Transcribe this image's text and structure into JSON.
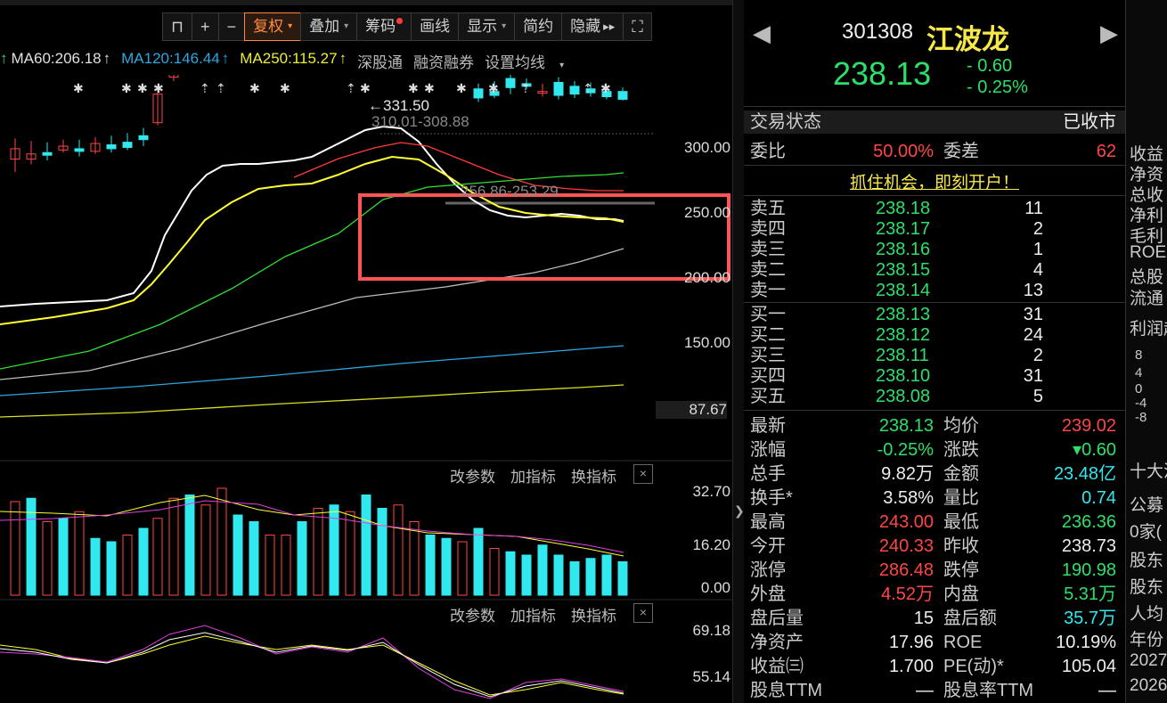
{
  "toolbar": {
    "items": [
      {
        "label": "",
        "icon": "lock-icon"
      },
      {
        "label": "+",
        "icon": "zoom-in-icon"
      },
      {
        "label": "−",
        "icon": "zoom-out-icon"
      },
      {
        "label": "复权",
        "dropdown": true,
        "selected": true
      },
      {
        "label": "叠加",
        "dropdown": true
      },
      {
        "label": "筹码",
        "badge": true
      },
      {
        "label": "画线"
      },
      {
        "label": "显示",
        "dropdown": true
      },
      {
        "label": "简约"
      },
      {
        "label": "隐藏",
        "arrow": "▸▸"
      },
      {
        "label": "",
        "icon": "fullscreen-icon"
      }
    ]
  },
  "ma_legend": {
    "ma60": "MA60:206.18",
    "ma120": "MA120:146.44",
    "ma250": "MA250:115.27",
    "arrow": "↑",
    "links": [
      "深股通",
      "融资融券"
    ],
    "setting": "设置均线"
  },
  "chart": {
    "annotations": {
      "high_label": "←331.50",
      "high_range": "310.01-308.88",
      "mid_range": "256.86-253.29"
    },
    "price_axis": [
      "300.00",
      "250.00",
      "200.00",
      "150.00"
    ],
    "min_label": "87.67",
    "panel_buttons": [
      "改参数",
      "加指标",
      "换指标"
    ],
    "close_icon": "×",
    "vol_axis": [
      "32.70",
      "16.20",
      "0.00"
    ],
    "ind_axis": [
      "69.18",
      "55.14"
    ],
    "colors": {
      "up": "#ff4646",
      "down": "#31e8ef",
      "ma5": "#ffffff",
      "ma10": "#ffff33",
      "ma20": "#ff3b3b",
      "ma30": "#33dd33",
      "ma60": "#bbbbbb",
      "ma120": "#2aa8e0",
      "ma250": "#dddd22",
      "highlight": "#ff5555"
    }
  },
  "stock": {
    "code": "301308",
    "name": "江波龙",
    "price": "238.13",
    "change": "- 0.60",
    "change_pct": "- 0.25%",
    "prev_arrow": "◀",
    "next_arrow": "▶"
  },
  "status": {
    "label": "交易状态",
    "value": "已收市"
  },
  "ratio": {
    "label1": "委比",
    "value1": "50.00%",
    "label2": "委差",
    "value2": "62"
  },
  "promo": "抓住机会，即刻开户！",
  "asks": [
    {
      "label": "卖五",
      "price": "238.18",
      "vol": "11"
    },
    {
      "label": "卖四",
      "price": "238.17",
      "vol": "2"
    },
    {
      "label": "卖三",
      "price": "238.16",
      "vol": "1"
    },
    {
      "label": "卖二",
      "price": "238.15",
      "vol": "4"
    },
    {
      "label": "卖一",
      "price": "238.14",
      "vol": "13"
    }
  ],
  "bids": [
    {
      "label": "买一",
      "price": "238.13",
      "vol": "31"
    },
    {
      "label": "买二",
      "price": "238.12",
      "vol": "24"
    },
    {
      "label": "买三",
      "price": "238.11",
      "vol": "2"
    },
    {
      "label": "买四",
      "price": "238.10",
      "vol": "31"
    },
    {
      "label": "买五",
      "price": "238.08",
      "vol": "5"
    }
  ],
  "stats": [
    {
      "l1": "最新",
      "v1": "238.13",
      "c1": "dn",
      "l2": "均价",
      "v2": "239.02",
      "c2": "up"
    },
    {
      "l1": "涨幅",
      "v1": "-0.25%",
      "c1": "dn",
      "l2": "涨跌",
      "v2": "▾0.60",
      "c2": "dn"
    },
    {
      "l1": "总手",
      "v1": "9.82万",
      "c1": "w",
      "l2": "金额",
      "v2": "23.48亿",
      "c2": "c"
    },
    {
      "l1": "换手*",
      "v1": "3.58%",
      "c1": "w",
      "l2": "量比",
      "v2": "0.74",
      "c2": "c"
    },
    {
      "l1": "最高",
      "v1": "243.00",
      "c1": "up",
      "l2": "最低",
      "v2": "236.36",
      "c2": "dn"
    },
    {
      "l1": "今开",
      "v1": "240.33",
      "c1": "up",
      "l2": "昨收",
      "v2": "238.73",
      "c2": "w"
    },
    {
      "l1": "涨停",
      "v1": "286.48",
      "c1": "up",
      "l2": "跌停",
      "v2": "190.98",
      "c2": "dn"
    },
    {
      "l1": "外盘",
      "v1": "4.52万",
      "c1": "up",
      "l2": "内盘",
      "v2": "5.31万",
      "c2": "dn"
    },
    {
      "l1": "盘后量",
      "v1": "15",
      "c1": "w",
      "l2": "盘后额",
      "v2": "35.7万",
      "c2": "c"
    },
    {
      "l1": "净资产",
      "v1": "17.96",
      "c1": "w",
      "l2": "ROE",
      "v2": "10.19%",
      "c2": "w"
    },
    {
      "l1": "收益㈢",
      "v1": "1.700",
      "c1": "w",
      "l2": "PE(动)*",
      "v2": "105.04",
      "c2": "w"
    },
    {
      "l1": "股息TTM",
      "v1": "—",
      "c1": "w",
      "l2": "股息率TTM",
      "v2": "—",
      "c2": "w"
    }
  ],
  "farright": {
    "items": [
      "收益",
      "净资",
      "总收",
      "净利",
      "毛利",
      "ROE",
      "总股",
      "流通",
      "利润趋",
      "8",
      "4",
      "0",
      "-4",
      "-8",
      "十大流",
      "公募",
      "0家(",
      "股东",
      "股东",
      "人均",
      "年份",
      "2027",
      "2026"
    ]
  }
}
